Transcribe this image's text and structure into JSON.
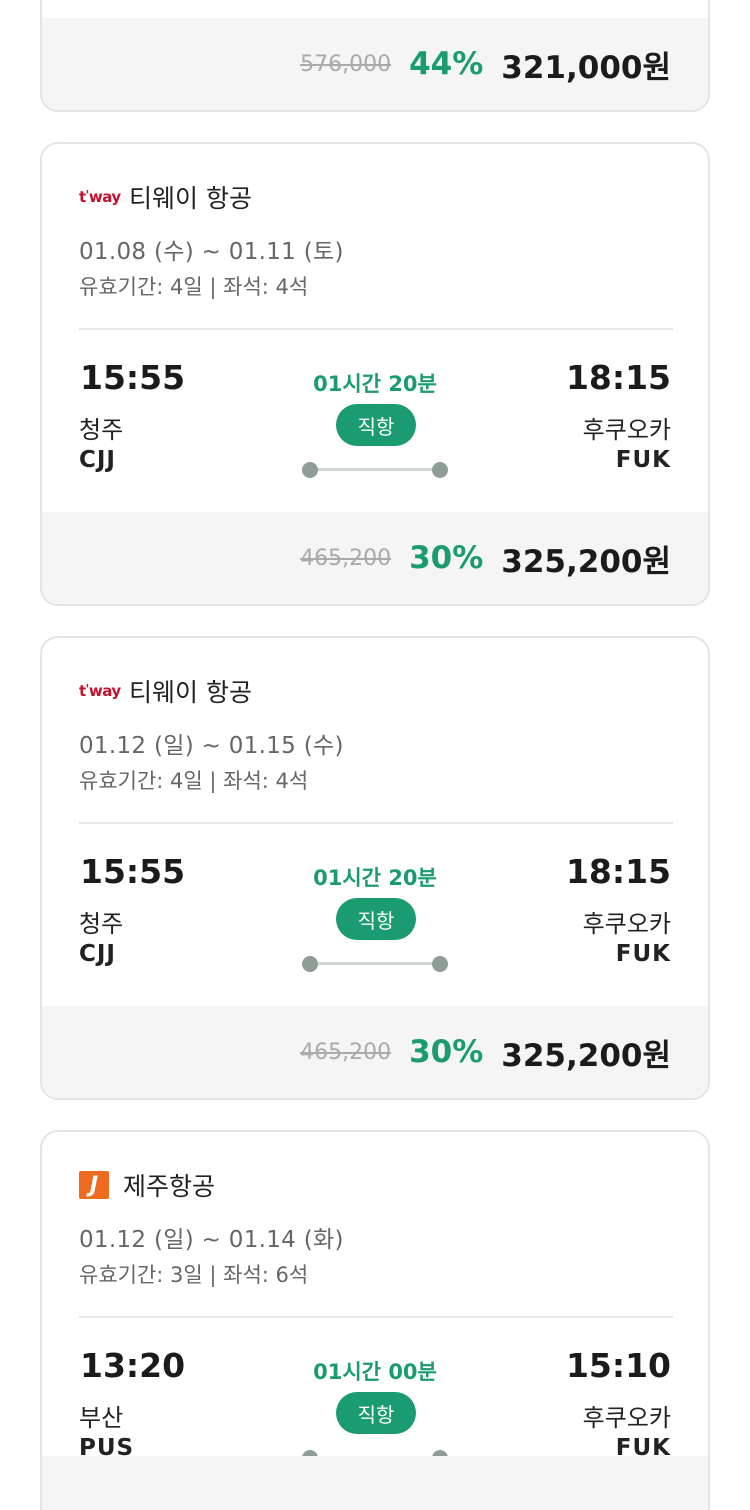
{
  "top_card": {
    "old_price": "576,000",
    "discount": "44%",
    "price": "321,000원"
  },
  "cards": [
    {
      "logo_icon": "tway-logo",
      "logo_text": "t'way",
      "airline": "티웨이 항공",
      "dates": "01.08 (수) ~ 01.11 (토)",
      "validity": "유효기간: 4일 | 좌석: 4석",
      "dep_time": "15:55",
      "dep_city": "청주",
      "dep_code": "CJJ",
      "duration": "01시간 20분",
      "direct": "직항",
      "arr_time": "18:15",
      "arr_city": "후쿠오카",
      "arr_code": "FUK",
      "old_price": "465,200",
      "discount": "30%",
      "price": "325,200원"
    },
    {
      "logo_icon": "tway-logo",
      "logo_text": "t'way",
      "airline": "티웨이 항공",
      "dates": "01.12 (일) ~ 01.15 (수)",
      "validity": "유효기간: 4일 | 좌석: 4석",
      "dep_time": "15:55",
      "dep_city": "청주",
      "dep_code": "CJJ",
      "duration": "01시간 20분",
      "direct": "직항",
      "arr_time": "18:15",
      "arr_city": "후쿠오카",
      "arr_code": "FUK",
      "old_price": "465,200",
      "discount": "30%",
      "price": "325,200원"
    },
    {
      "logo_icon": "jeju-air-logo",
      "logo_text": "J",
      "airline": "제주항공",
      "dates": "01.12 (일) ~ 01.14 (화)",
      "validity": "유효기간: 3일 | 좌석: 6석",
      "dep_time": "13:20",
      "dep_city": "부산",
      "dep_code": "PUS",
      "duration": "01시간 00분",
      "direct": "직항",
      "arr_time": "15:10",
      "arr_city": "후쿠오카",
      "arr_code": "FUK",
      "old_price": "",
      "discount": "",
      "price": ""
    }
  ],
  "colors": {
    "accent": "#1a9b72",
    "price_bar_bg": "#f5f5f5",
    "tway_red": "#c8102e",
    "jeju_orange": "#ee6b1f"
  }
}
